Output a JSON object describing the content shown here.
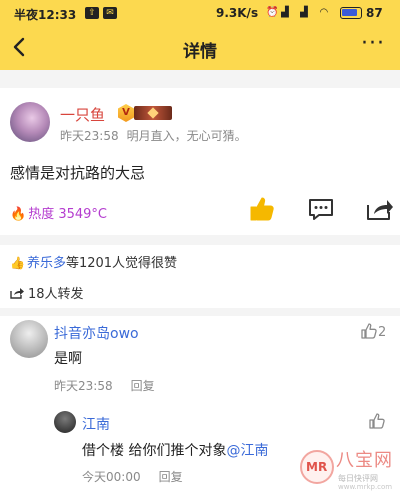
{
  "status_bar": {
    "time": "半夜12:33",
    "net_speed": "9.3K/s",
    "battery_text": "87",
    "battery_level": 0.87
  },
  "nav": {
    "title": "详情",
    "more_label": "···"
  },
  "post": {
    "author": "一只鱼",
    "vip_badge": "V",
    "time": "昨天23:58",
    "signature": "明月直入，无心可猜。",
    "content": "感情是对抗路的大忌",
    "heat": "热度 3549°C"
  },
  "engagement": {
    "liker": "养乐多",
    "likes_text": "等1201人觉得很赞",
    "reposts_text": "18人转发"
  },
  "comment": {
    "author": "抖音亦岛owo",
    "likes": "2",
    "text": "是啊",
    "time": "昨天23:58",
    "reply_label": "回复"
  },
  "reply": {
    "author": "江南",
    "text_prefix": "借个楼 给你们推个对象",
    "mention": "@江南",
    "time": "今天00:00",
    "reply_label": "回复"
  },
  "watermark": {
    "brand": "八宝网",
    "tagline": "每日快评网",
    "url": "www.mrkp.com"
  },
  "colors": {
    "header_bg": "#FCD94F",
    "accent_yellow": "#F5B800",
    "link_blue": "#3a6ad8",
    "author_red": "#d8453c",
    "heat_purple": "#b43ccf"
  }
}
